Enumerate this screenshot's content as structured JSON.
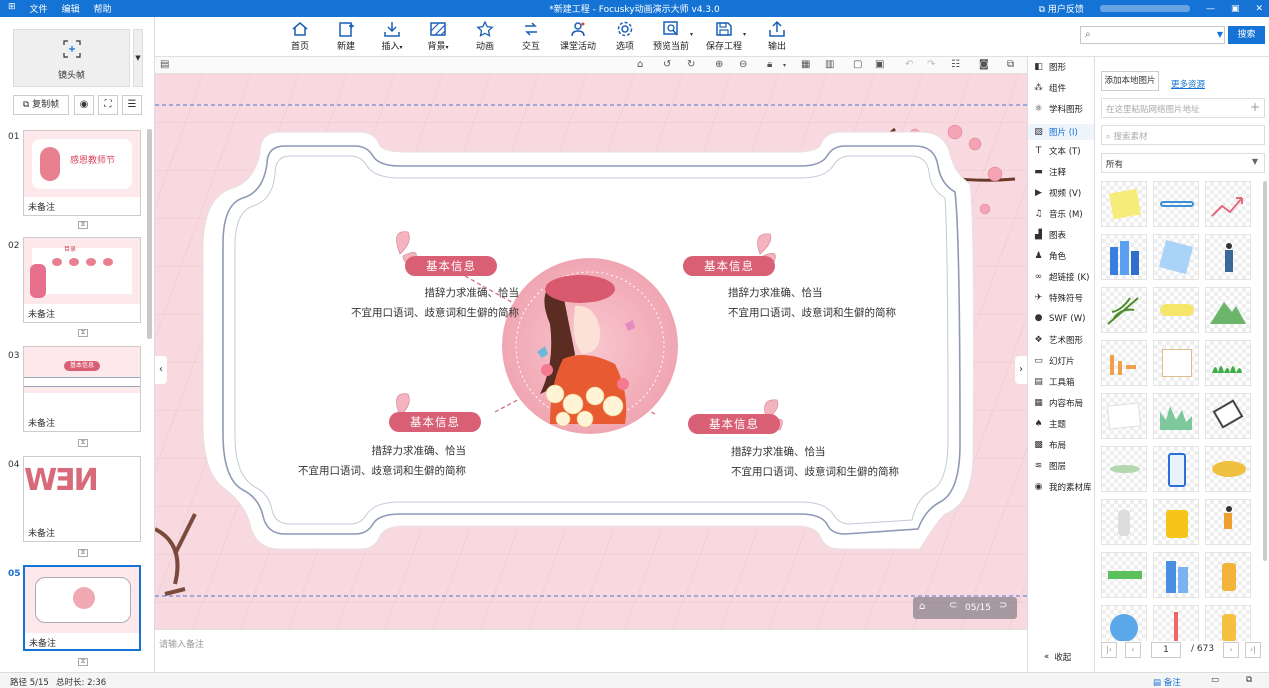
{
  "titlebar": {
    "menu": [
      "文件",
      "编辑",
      "帮助"
    ],
    "title": "*新建工程 - Focusky动画演示大师  v4.3.0",
    "feedback": "用户反馈"
  },
  "toolbar": {
    "items": [
      "首页",
      "新建",
      "插入",
      "背景",
      "动画",
      "交互",
      "课堂活动",
      "选项",
      "预览当前",
      "保存工程",
      "输出"
    ]
  },
  "search": {
    "placeholder": "",
    "button": "搜索"
  },
  "left": {
    "camera_frame": "镜头帧",
    "copy_frame": "复制帧",
    "slides": [
      {
        "num": "01",
        "note": "未备注",
        "title": "感恩教师节"
      },
      {
        "num": "02",
        "note": "未备注",
        "title": "目录"
      },
      {
        "num": "03",
        "note": "未备注",
        "title": "基本信息"
      },
      {
        "num": "04",
        "note": "未备注",
        "title": ""
      },
      {
        "num": "05",
        "note": "未备注",
        "title": ""
      }
    ]
  },
  "canvas": {
    "blocks": [
      {
        "title": "基本信息",
        "line1": "措辞力求准确、恰当",
        "line2": "不宜用口语词、歧意词和生僻的简称"
      },
      {
        "title": "基本信息",
        "line1": "措辞力求准确、恰当",
        "line2": "不宜用口语词、歧意词和生僻的简称"
      },
      {
        "title": "基本信息",
        "line1": "措辞力求准确、恰当",
        "line2": "不宜用口语词、歧意词和生僻的简称"
      },
      {
        "title": "基本信息",
        "line1": "措辞力求准确、恰当",
        "line2": "不宜用口语词、歧意词和生僻的简称"
      }
    ],
    "page_indicator": "05/15"
  },
  "note_placeholder": "请输入备注",
  "rightnav": {
    "items": [
      "图形",
      "组件",
      "学科图形",
      "图片 (I)",
      "文本 (T)",
      "注释",
      "视频 (V)",
      "音乐 (M)",
      "图表",
      "角色",
      "超链接 (K)",
      "特殊符号",
      "SWF (W)",
      "艺术图形",
      "幻灯片",
      "工具箱",
      "内容布局",
      "主题",
      "布局",
      "图层",
      "我的素材库"
    ],
    "collapse": "收起"
  },
  "assets": {
    "add_local": "添加本地图片",
    "more": "更多资源",
    "url_placeholder": "在这里粘贴网络图片地址",
    "search_placeholder": "搜索素材",
    "filter": "所有",
    "page": "1",
    "total": "/ 673"
  },
  "status": {
    "path": "路径 5/15",
    "duration": "总时长: 2:36",
    "note_btn": "备注"
  },
  "colors": {
    "accent": "#1473d4",
    "pill": "#d95f74",
    "canvas_bg": "#f7d9df"
  }
}
